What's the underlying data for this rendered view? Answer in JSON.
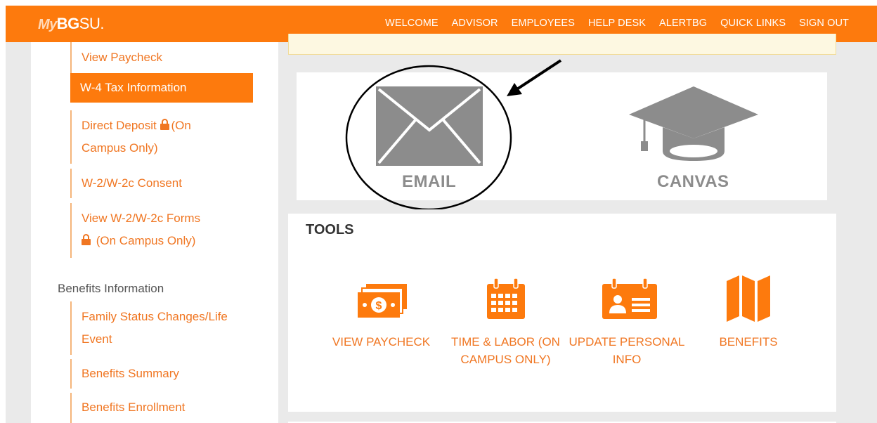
{
  "header": {
    "logo_my": "My",
    "logo_bg": "BG",
    "logo_su": "SU.",
    "nav": [
      "WELCOME",
      "ADVISOR",
      "EMPLOYEES",
      "HELP DESK",
      "ALERTBG",
      "QUICK LINKS",
      "SIGN OUT"
    ]
  },
  "sidebar": {
    "view_paycheck": "View Paycheck",
    "w4": "W-4 Tax Information",
    "direct_deposit_1": "Direct Deposit",
    "direct_deposit_2": "(On",
    "direct_deposit_3": "Campus Only)",
    "w2_consent": "W-2/W-2c Consent",
    "w2_forms_1": "View W-2/W-2c Forms",
    "w2_forms_2": "(On Campus Only)",
    "benefits_heading": "Benefits Information",
    "family_1": "Family Status Changes/Life",
    "family_2": "Event",
    "benefits_summary": "Benefits Summary",
    "benefits_enrollment": "Benefits Enrollment"
  },
  "apps": {
    "email": "EMAIL",
    "canvas": "CANVAS"
  },
  "tools": {
    "title": "TOOLS",
    "view_paycheck": "VIEW PAYCHECK",
    "time_labor_1": "TIME & LABOR (ON",
    "time_labor_2": "CAMPUS ONLY)",
    "update_1": "UPDATE PERSONAL",
    "update_2": "INFO",
    "benefits": "BENEFITS"
  },
  "colors": {
    "brand_orange": "#fd7a0d",
    "icon_gray": "#8c8c8c"
  },
  "icons": [
    "envelope-icon",
    "graduation-cap-icon",
    "money-icon",
    "calendar-icon",
    "id-card-icon",
    "map-icon",
    "lock-icon"
  ]
}
